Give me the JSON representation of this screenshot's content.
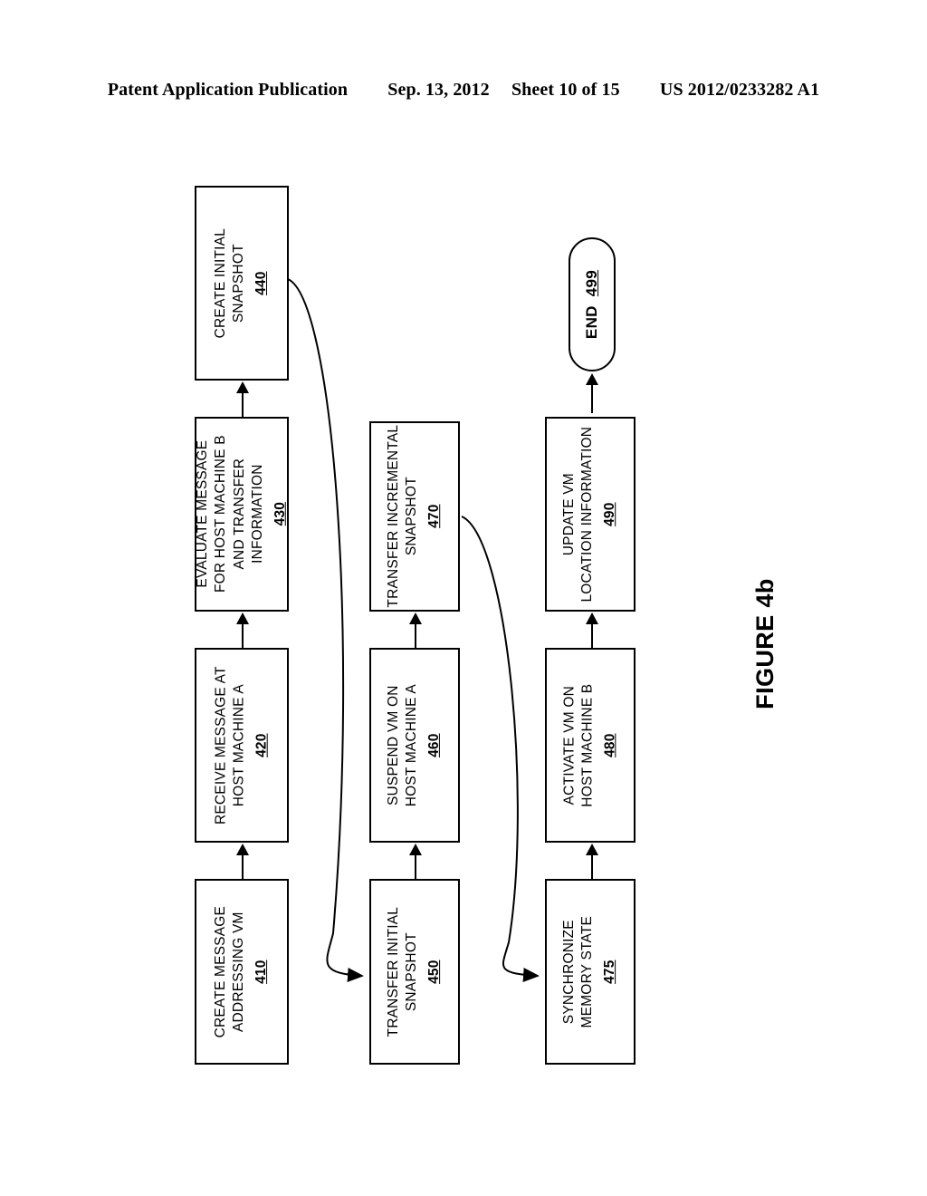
{
  "header": {
    "publication": "Patent Application Publication",
    "date": "Sep. 13, 2012",
    "sheet": "Sheet 10 of 15",
    "patent_number": "US 2012/0233282 A1"
  },
  "figure": {
    "caption": "FIGURE 4b"
  },
  "diagram": {
    "type": "flowchart",
    "orientation": "rotated-90-ccw",
    "nodes": [
      {
        "id": "410",
        "shape": "process",
        "lines": [
          "CREATE MESSAGE",
          "ADDRESSING VM"
        ],
        "ref": "410"
      },
      {
        "id": "420",
        "shape": "process",
        "lines": [
          "RECEIVE MESSAGE AT",
          "HOST MACHINE A"
        ],
        "ref": "420"
      },
      {
        "id": "430",
        "shape": "process",
        "lines": [
          "EVALUATE MESSAGE",
          "FOR HOST MACHINE B",
          "AND TRANSFER",
          "INFORMATION"
        ],
        "ref": "430"
      },
      {
        "id": "440",
        "shape": "process",
        "lines": [
          "CREATE INITIAL",
          "SNAPSHOT"
        ],
        "ref": "440"
      },
      {
        "id": "450",
        "shape": "process",
        "lines": [
          "TRANSFER INITIAL",
          "SNAPSHOT"
        ],
        "ref": "450"
      },
      {
        "id": "460",
        "shape": "process",
        "lines": [
          "SUSPEND VM ON",
          "HOST MACHINE A"
        ],
        "ref": "460"
      },
      {
        "id": "470",
        "shape": "process",
        "lines": [
          "TRANSFER INCREMENTAL",
          "SNAPSHOT"
        ],
        "ref": "470"
      },
      {
        "id": "475",
        "shape": "process",
        "lines": [
          "SYNCHRONIZE",
          "MEMORY STATE"
        ],
        "ref": "475"
      },
      {
        "id": "480",
        "shape": "process",
        "lines": [
          "ACTIVATE VM ON",
          "HOST MACHINE B"
        ],
        "ref": "480"
      },
      {
        "id": "490",
        "shape": "process",
        "lines": [
          "UPDATE VM",
          "LOCATION INFORMATION"
        ],
        "ref": "490"
      },
      {
        "id": "499",
        "shape": "terminator",
        "label": "END",
        "ref": "499"
      }
    ],
    "edges": [
      {
        "from": "410",
        "to": "420",
        "style": "straight"
      },
      {
        "from": "420",
        "to": "430",
        "style": "straight"
      },
      {
        "from": "430",
        "to": "440",
        "style": "straight"
      },
      {
        "from": "440",
        "to": "450",
        "style": "curved"
      },
      {
        "from": "450",
        "to": "460",
        "style": "straight"
      },
      {
        "from": "460",
        "to": "470",
        "style": "straight"
      },
      {
        "from": "470",
        "to": "475",
        "style": "curved"
      },
      {
        "from": "475",
        "to": "480",
        "style": "straight"
      },
      {
        "from": "480",
        "to": "490",
        "style": "straight"
      },
      {
        "from": "490",
        "to": "499",
        "style": "straight"
      }
    ]
  },
  "colors": {
    "stroke": "#000000",
    "fill": "#ffffff"
  }
}
